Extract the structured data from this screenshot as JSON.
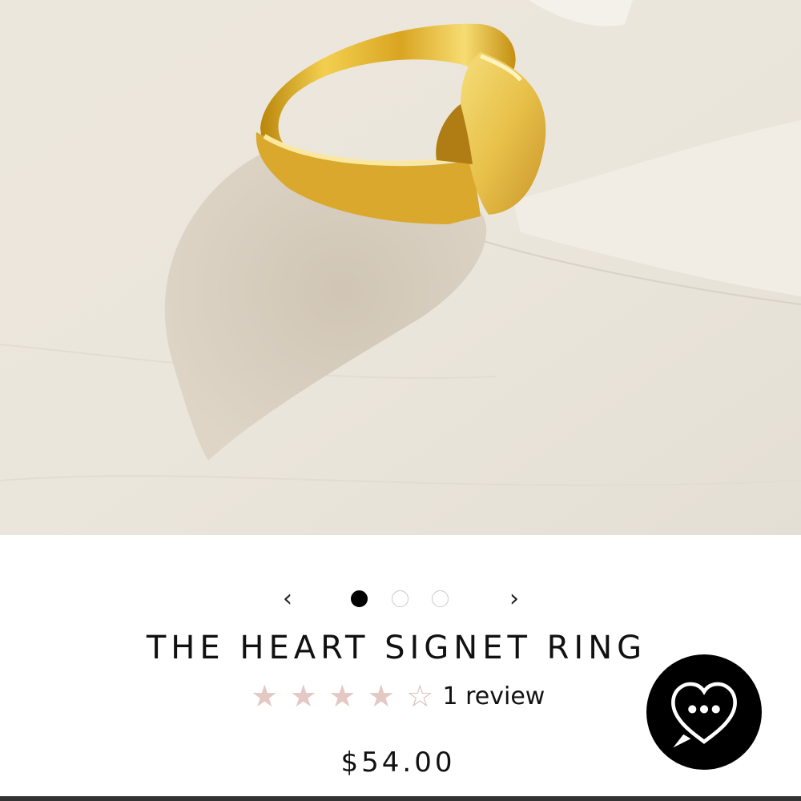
{
  "product": {
    "title": "THE HEART SIGNET RING",
    "price": "$54.00",
    "rating": {
      "value": 4,
      "max": 5,
      "review_text": "1 review"
    },
    "image_alt": "gold heart signet ring on textured white surface"
  },
  "carousel": {
    "prev_icon": "‹",
    "next_icon": "›",
    "slide_count": 3,
    "active_slide": 1
  },
  "icons": {
    "star_full": "★",
    "star_empty": "☆",
    "prev": "chevron-left-icon",
    "next": "chevron-right-icon",
    "chat": "chat-heart-icon"
  },
  "colors": {
    "gold": "#d4a020",
    "star": "#e3c8c3",
    "chat_bg": "#000000"
  }
}
